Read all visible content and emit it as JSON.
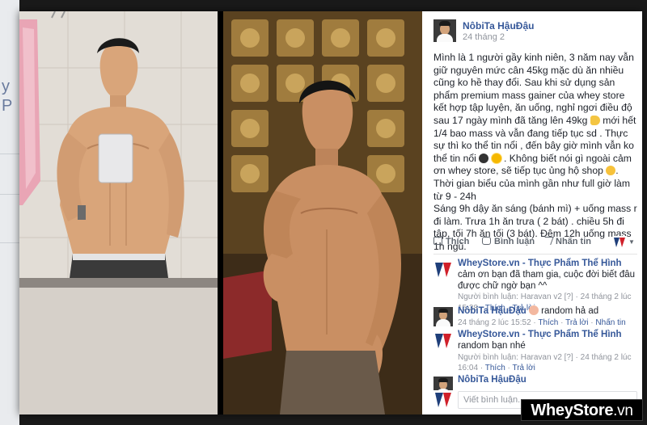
{
  "post": {
    "author": "NôbiTa HậuĐậu",
    "date": "24 tháng 2",
    "body": [
      "Mình là 1 người gầy kinh niên, 3 năm nay vẫn giữ nguyên mức cân 45kg mặc dù ăn nhiều cũng ko hề thay đổi. Sau khi sử dụng sản phẩm premium mass gainer của whey store kết hợp tập luyện, ăn uống, nghỉ ngơi điều độ sau 17 ngày mình đã tăng lên 49kg",
      "mới hết 1/4 bao mass và vẫn đang tiếp tục sd . Thực sự thì ko thể tin nổi , đến bây giờ mình vẫn ko thể tin nổi",
      ". Không biết nói gì ngoài cảm ơn whey store, sẽ tiếp tục ủng hộ shop",
      ".",
      "Thời gian biểu của mình gần như full giờ làm từ 9 - 24h",
      "Sáng 9h dậy ăn sáng (bánh mì) + uống mass r đi làm. Trưa 1h ăn trưa ( 2 bát) . chiều 5h đi tập, tối 7h ăn tối (3 bát). Đêm 12h uống mass 1h ngủ."
    ]
  },
  "actions": {
    "like": "Thích",
    "comment": "Bình luận",
    "share": "Nhấn tin"
  },
  "comments": [
    {
      "name": "WheyStore.vn - Thực Phẩm Thể Hình",
      "text": "cảm ơn bạn đã tham gia, cuộc đời biết đâu được chữ ngờ bạn ^^",
      "meta_prefix": "Người bình luận: Haravan v2 [?] · 24 tháng 2 lúc 15:38 ·",
      "like": "Thích",
      "reply": "Trả lời"
    },
    {
      "name": "NôbiTa HậuĐậu",
      "text": "random hả ad",
      "meta_prefix": "24 tháng 2 lúc 15:52 ·",
      "like": "Thích",
      "reply": "Trả lời",
      "extra": "Nhấn tin"
    },
    {
      "name": "WheyStore.vn - Thực Phẩm Thể Hình",
      "text": "random bạn nhé",
      "meta_prefix": "Người bình luận: Haravan v2 [?] · 24 tháng 2 lúc 16:04 ·",
      "like": "Thích",
      "reply": "Trả lời"
    },
    {
      "name": "NôbiTa HậuĐậu",
      "text": ""
    }
  ],
  "input": {
    "placeholder": "Viết bình luận..."
  },
  "watermark": {
    "brand": "WheyStore",
    "suffix": ".vn"
  },
  "colors": {
    "link": "#365899",
    "meta": "#90949c",
    "text": "#1d2129",
    "brand_red": "#d0202a",
    "brand_navy": "#1f3f7a"
  },
  "icons": [
    "like-icon",
    "comment-icon",
    "share-icon",
    "chevron-down-icon"
  ]
}
